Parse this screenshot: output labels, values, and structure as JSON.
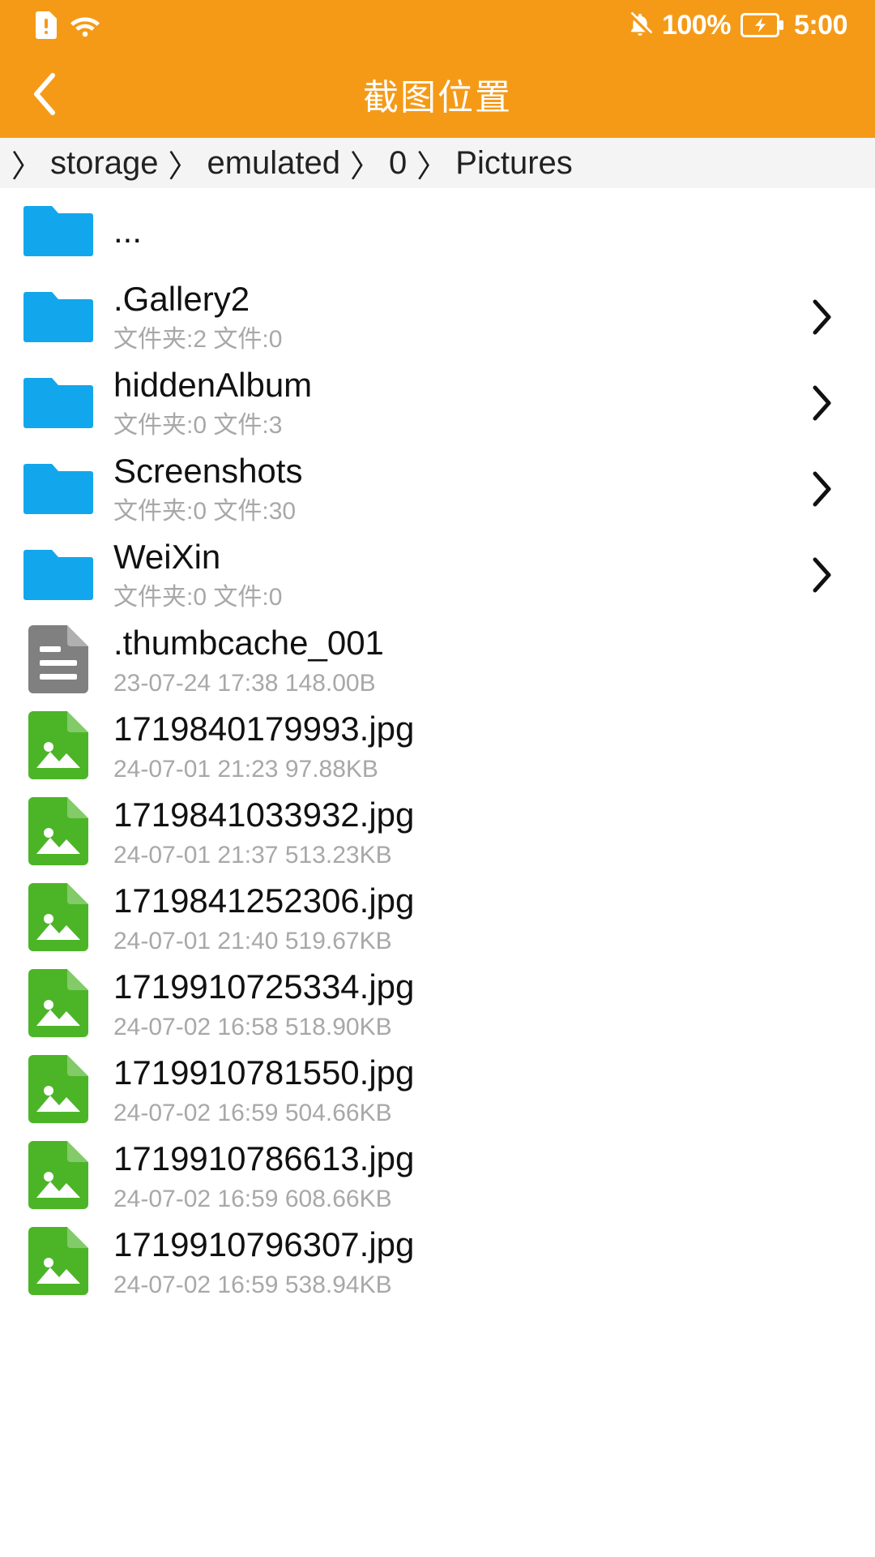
{
  "status_bar": {
    "icons_left": [
      "sim-alert-icon",
      "wifi-icon"
    ],
    "mute_icon": "bell-mute-icon",
    "battery_percent": "100%",
    "battery_icon": "battery-charging-icon",
    "time": "5:00"
  },
  "app_bar": {
    "back_icon": "back-chevron-icon",
    "title": "截图位置"
  },
  "breadcrumb": {
    "separator": "〉",
    "segments": [
      "storage",
      "emulated",
      "0",
      "Pictures"
    ]
  },
  "colors": {
    "accent_orange": "#F59A17",
    "folder_blue": "#12A7EC",
    "image_green": "#4CB527",
    "doc_gray": "#808080",
    "breadcrumb_bg": "#F4F4F4",
    "subtitle_gray": "#A8A8A8"
  },
  "list": {
    "items": [
      {
        "icon": "folder-icon",
        "type": "folder",
        "name": "...",
        "subtitle": "",
        "chevron": false
      },
      {
        "icon": "folder-icon",
        "type": "folder",
        "name": ".Gallery2",
        "subtitle": "文件夹:2 文件:0",
        "chevron": true
      },
      {
        "icon": "folder-icon",
        "type": "folder",
        "name": "hiddenAlbum",
        "subtitle": "文件夹:0 文件:3",
        "chevron": true
      },
      {
        "icon": "folder-icon",
        "type": "folder",
        "name": "Screenshots",
        "subtitle": "文件夹:0 文件:30",
        "chevron": true
      },
      {
        "icon": "folder-icon",
        "type": "folder",
        "name": "WeiXin",
        "subtitle": "文件夹:0 文件:0",
        "chevron": true
      },
      {
        "icon": "document-file-icon",
        "type": "document",
        "name": ".thumbcache_001",
        "subtitle": "23-07-24 17:38  148.00B",
        "chevron": false
      },
      {
        "icon": "image-file-icon",
        "type": "image",
        "name": "1719840179993.jpg",
        "subtitle": "24-07-01 21:23  97.88KB",
        "chevron": false
      },
      {
        "icon": "image-file-icon",
        "type": "image",
        "name": "1719841033932.jpg",
        "subtitle": "24-07-01 21:37  513.23KB",
        "chevron": false
      },
      {
        "icon": "image-file-icon",
        "type": "image",
        "name": "1719841252306.jpg",
        "subtitle": "24-07-01 21:40  519.67KB",
        "chevron": false
      },
      {
        "icon": "image-file-icon",
        "type": "image",
        "name": "1719910725334.jpg",
        "subtitle": "24-07-02 16:58  518.90KB",
        "chevron": false
      },
      {
        "icon": "image-file-icon",
        "type": "image",
        "name": "1719910781550.jpg",
        "subtitle": "24-07-02 16:59  504.66KB",
        "chevron": false
      },
      {
        "icon": "image-file-icon",
        "type": "image",
        "name": "1719910786613.jpg",
        "subtitle": "24-07-02 16:59  608.66KB",
        "chevron": false
      },
      {
        "icon": "image-file-icon",
        "type": "image",
        "name": "1719910796307.jpg",
        "subtitle": "24-07-02 16:59  538.94KB",
        "chevron": false
      }
    ]
  }
}
